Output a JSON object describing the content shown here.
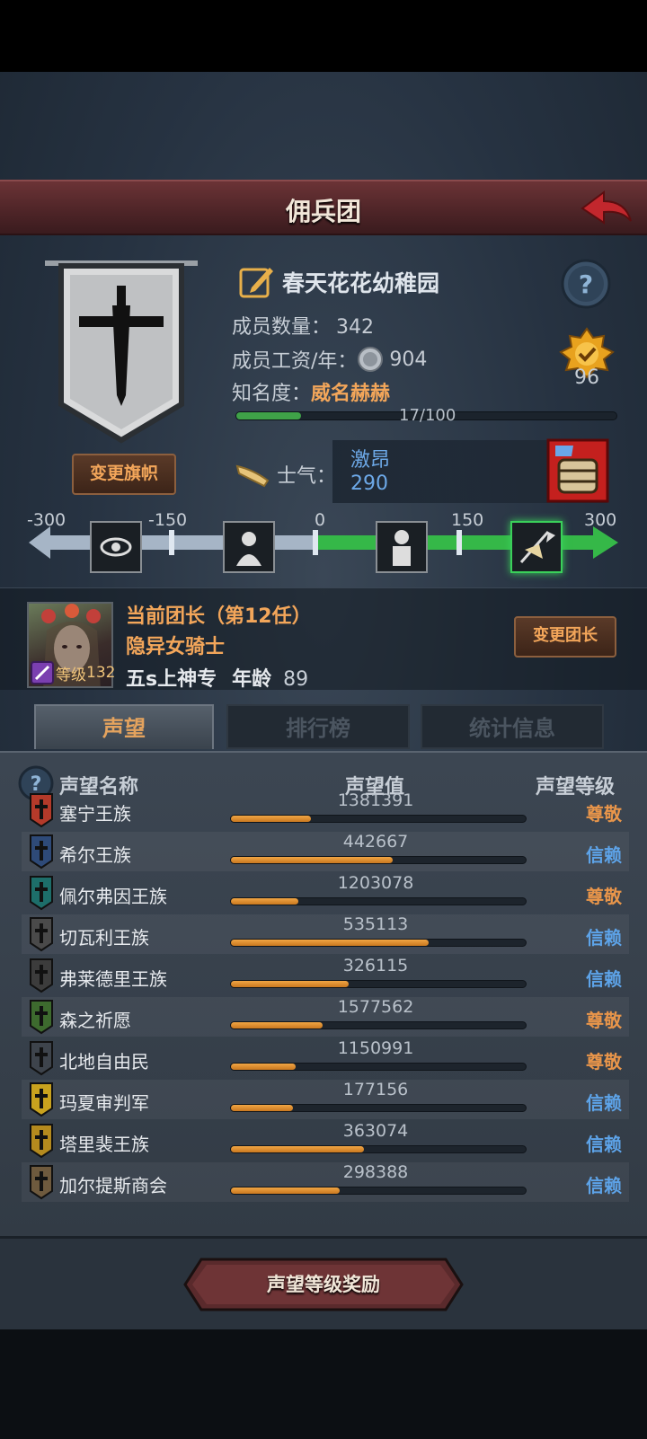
{
  "header": {
    "title": "佣兵团"
  },
  "guild": {
    "name": "春天花花幼稚园",
    "change_flag_label": "变更旗帜",
    "members_label": "成员数量：",
    "members_value": "342",
    "wage_label": "成员工资/年：",
    "wage_value": "904",
    "fame_label": "知名度：",
    "fame_title": "威名赫赫",
    "fame_progress": "17/100",
    "fame_fraction": 0.17,
    "medal_value": "96"
  },
  "morale": {
    "label": "士气：",
    "status": "激昂",
    "value": "290",
    "ticks": [
      "-300",
      "-150",
      "0",
      "150",
      "300"
    ]
  },
  "leader": {
    "title": "当前团长（第12任）",
    "name": "隐异女骑士",
    "level_label": "等级",
    "level_value": "132",
    "guild_rank": "五s上神专",
    "age_label": "年龄",
    "age_value": "89",
    "change_label": "变更团长"
  },
  "tabs": [
    "声望",
    "排行榜",
    "统计信息"
  ],
  "table": {
    "headers": [
      "声望名称",
      "声望值",
      "声望等级"
    ],
    "rows": [
      {
        "name": "塞宁王族",
        "value": "1381391",
        "fill": 0.27,
        "level": "尊敬",
        "level_color": "#e8954a",
        "emblem_color": "#b43a2a"
      },
      {
        "name": "希尔王族",
        "value": "442667",
        "fill": 0.55,
        "level": "信赖",
        "level_color": "#5da3e8",
        "emblem_color": "#2e4a78"
      },
      {
        "name": "佩尔弗因王族",
        "value": "1203078",
        "fill": 0.23,
        "level": "尊敬",
        "level_color": "#e8954a",
        "emblem_color": "#1d6e6a"
      },
      {
        "name": "切瓦利王族",
        "value": "535113",
        "fill": 0.67,
        "level": "信赖",
        "level_color": "#5da3e8",
        "emblem_color": "#4a4a4a"
      },
      {
        "name": "弗莱德里王族",
        "value": "326115",
        "fill": 0.4,
        "level": "信赖",
        "level_color": "#5da3e8",
        "emblem_color": "#3c3c3c"
      },
      {
        "name": "森之祈愿",
        "value": "1577562",
        "fill": 0.31,
        "level": "尊敬",
        "level_color": "#e8954a",
        "emblem_color": "#3d6a2e"
      },
      {
        "name": "北地自由民",
        "value": "1150991",
        "fill": 0.22,
        "level": "尊敬",
        "level_color": "#e8954a",
        "emblem_color": "#3e444c"
      },
      {
        "name": "玛夏审判军",
        "value": "177156",
        "fill": 0.21,
        "level": "信赖",
        "level_color": "#5da3e8",
        "emblem_color": "#c9a21e"
      },
      {
        "name": "塔里裴王族",
        "value": "363074",
        "fill": 0.45,
        "level": "信赖",
        "level_color": "#5da3e8",
        "emblem_color": "#b48a1e"
      },
      {
        "name": "加尔提斯商会",
        "value": "298388",
        "fill": 0.37,
        "level": "信赖",
        "level_color": "#5da3e8",
        "emblem_color": "#6e5a3e"
      }
    ]
  },
  "reward_button": "声望等级奖励"
}
